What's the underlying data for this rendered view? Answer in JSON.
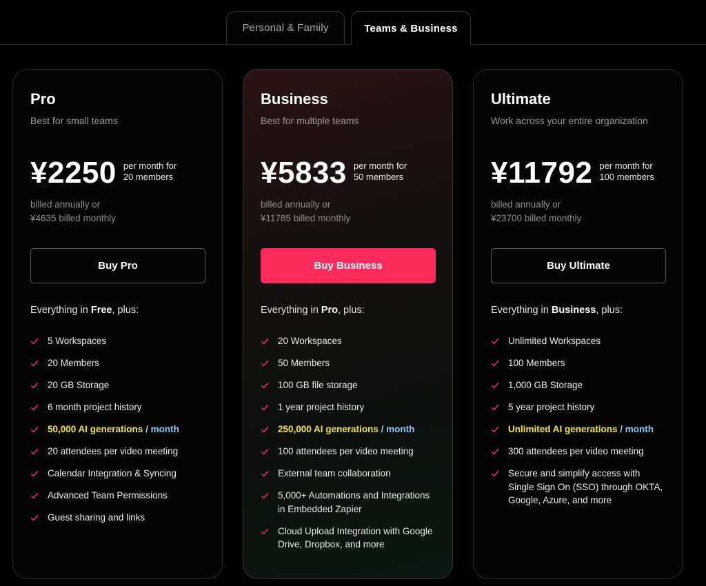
{
  "tabs": [
    {
      "label": "Personal & Family",
      "active": false
    },
    {
      "label": "Teams & Business",
      "active": true
    }
  ],
  "colors": {
    "accent": "#fb2c5c",
    "check": "#e8355f",
    "background": "#000000"
  },
  "plans": [
    {
      "name": "Pro",
      "tagline": "Best for small teams",
      "price": "¥2250",
      "price_note_1": "per month for",
      "price_note_2": "20 members",
      "billing_1": "billed annually or",
      "billing_2": "¥4635 billed monthly",
      "button": "Buy Pro",
      "everything_prefix": "Everything in ",
      "everything_plan": "Free",
      "everything_suffix": ", plus:",
      "features": [
        "5 Workspaces",
        "20 Members",
        "20 GB Storage",
        "6 month project history"
      ],
      "ai_generations": "50,000 AI generations",
      "ai_sep": " / ",
      "ai_unit": "month",
      "features_after": [
        "20 attendees per video meeting",
        "Calendar Integration & Syncing",
        "Advanced Team Permissions",
        "Guest sharing and links"
      ]
    },
    {
      "name": "Business",
      "tagline": "Best for multiple teams",
      "price": "¥5833",
      "price_note_1": "per month for",
      "price_note_2": "50 members",
      "billing_1": "billed annually or",
      "billing_2": "¥11785 billed monthly",
      "button": "Buy Business",
      "everything_prefix": "Everything in ",
      "everything_plan": "Pro",
      "everything_suffix": ", plus:",
      "features": [
        "20 Workspaces",
        "50 Members",
        "100 GB file storage",
        "1 year project history"
      ],
      "ai_generations": "250,000 AI generations",
      "ai_sep": " / ",
      "ai_unit": "month",
      "features_after": [
        "100 attendees per video meeting",
        "External team collaboration",
        "5,000+ Automations and Integrations in Embedded Zapier",
        "Cloud Upload Integration with Google Drive, Dropbox, and more"
      ]
    },
    {
      "name": "Ultimate",
      "tagline": "Work across your entire organization",
      "price": "¥11792",
      "price_note_1": "per month for",
      "price_note_2": "100 members",
      "billing_1": "billed annually or",
      "billing_2": "¥23700 billed monthly",
      "button": "Buy Ultimate",
      "everything_prefix": "Everything in ",
      "everything_plan": "Business",
      "everything_suffix": ", plus:",
      "features": [
        "Unlimited Workspaces",
        "100 Members",
        "1,000 GB Storage",
        "5 year project history"
      ],
      "ai_generations": "Unlimited AI generations",
      "ai_sep": " / ",
      "ai_unit": "month",
      "features_after": [
        "300 attendees per video meeting",
        "Secure and simplify access with Single Sign On (SSO) through OKTA, Google, Azure, and more"
      ]
    }
  ]
}
